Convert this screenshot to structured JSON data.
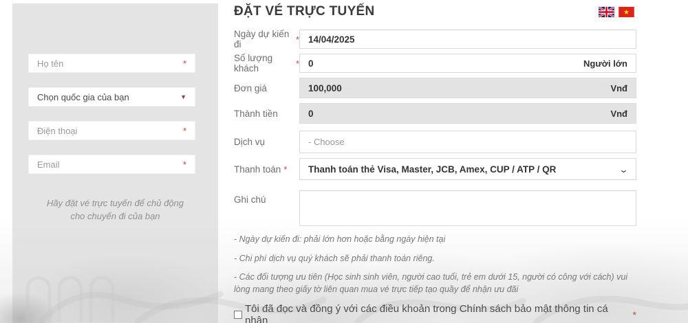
{
  "misc": {
    "asterisk": "*",
    "chevron": "⌄",
    "arrow_down": "▼"
  },
  "header": {
    "title": "ĐẶT VÉ TRỰC TUYẾN"
  },
  "sidebar": {
    "fullname_placeholder": "Họ tên",
    "country_value": "Chọn quốc gia của bạn",
    "phone_placeholder": "Điện thoại",
    "email_placeholder": "Email",
    "promo_line1": "Hãy đặt vé trực tuyến để chủ động",
    "promo_line2": "cho chuyến đi của bạn"
  },
  "form": {
    "date": {
      "label": "Ngày dự kiến đi",
      "value": "14/04/2025"
    },
    "quantity": {
      "label": "Số lượng khách",
      "value": "0",
      "unit": "Người lớn"
    },
    "unit_price": {
      "label": "Đơn giá",
      "value": "100,000",
      "unit": "Vnđ"
    },
    "total": {
      "label": "Thành tiền",
      "value": "0",
      "unit": "Vnđ"
    },
    "service": {
      "label": "Dịch vụ",
      "placeholder": "- Choose"
    },
    "payment": {
      "label": "Thanh toán",
      "value": "Thanh toán thẻ Visa, Master, JCB, Amex, CUP / ATP / QR"
    },
    "note": {
      "label": "Ghi chú",
      "value": ""
    }
  },
  "notes": [
    "- Ngày dự kiến đi: phải lớn hơn hoặc bằng ngày hiện tại",
    "- Chi phí dịch vụ quý khách sẽ phải thanh toán riêng.",
    "- Các đối tượng ưu tiên (Học sinh sinh viên, người cao tuổi, trẻ em dưới 15, người có công với cách) vui lòng mang theo giấy tờ liên quan mua vé trực tiếp tạo quầy để nhận ưu đãi"
  ],
  "agreement": {
    "text": "Tôi đã đọc và đồng ý với các điều khoản trong Chính sách bảo mật thông tin cá nhân"
  },
  "colors": {
    "accent_red": "#b94a48",
    "sidebar_bg": "#e4e4e4",
    "readonly_bg": "#e3e3e3",
    "flag_vn_red": "#da251d",
    "flag_vn_star": "#ffde00",
    "flag_uk_blue": "#012169",
    "flag_uk_red": "#c8102e"
  }
}
